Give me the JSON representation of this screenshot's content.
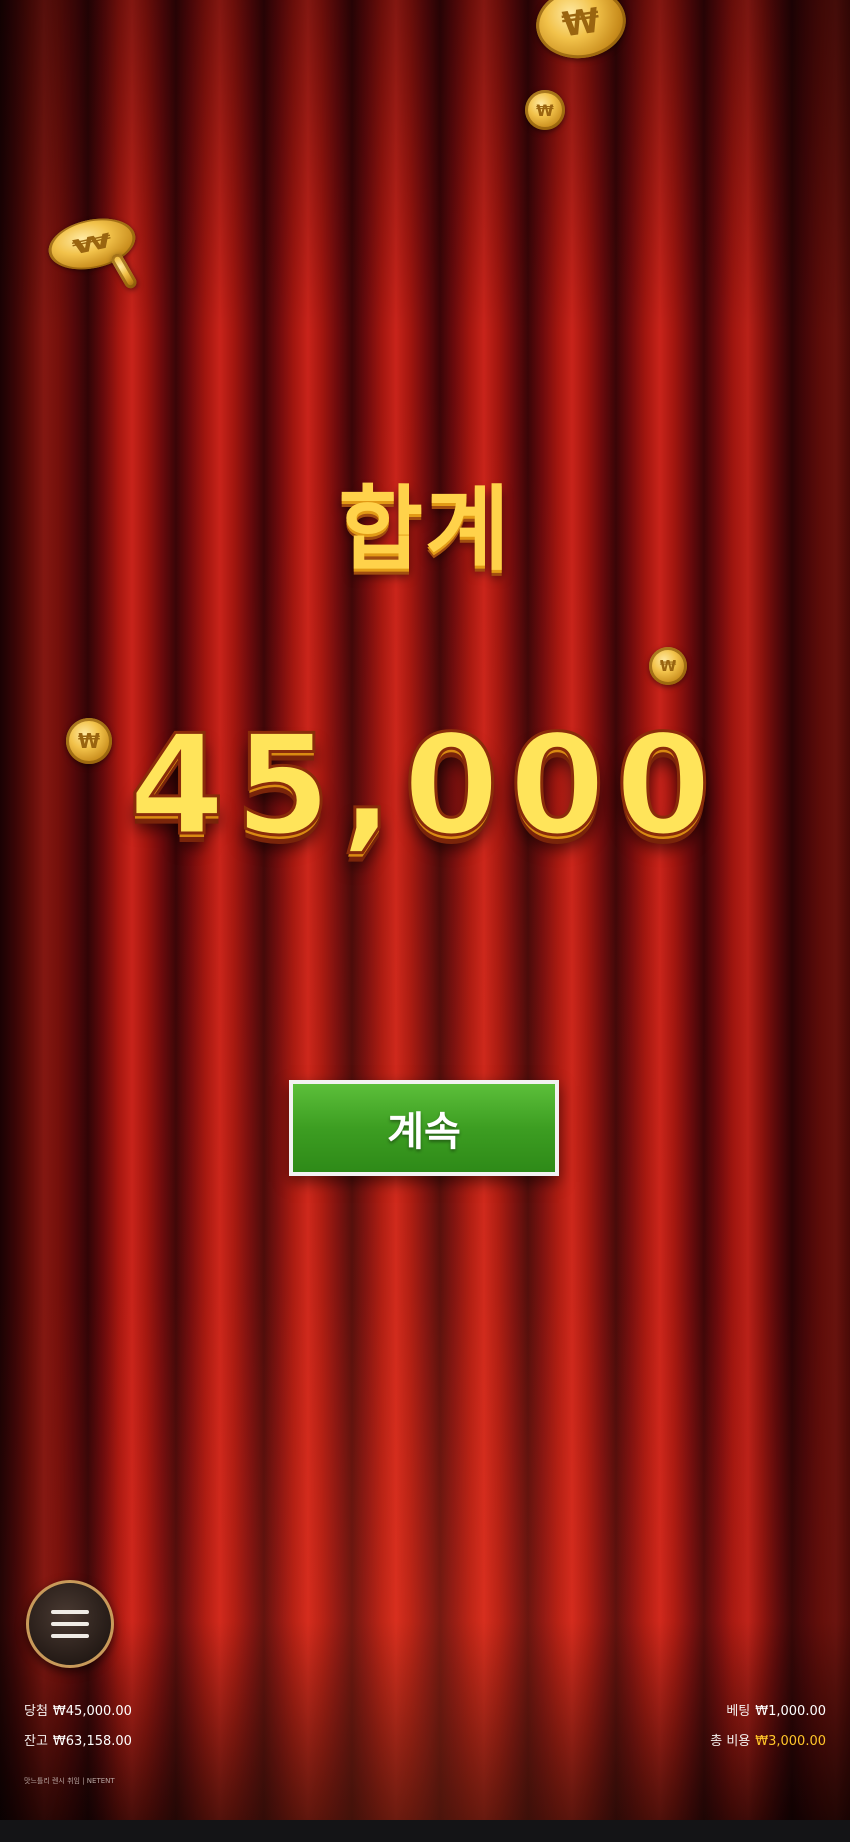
{
  "game": {
    "title": "합계",
    "win_amount": "45,000",
    "continue_label": "계속"
  },
  "coins": {
    "symbol": "₩"
  },
  "menu": {
    "icon": "hamburger-menu-icon"
  },
  "info": {
    "win_label": "당첨",
    "win_value": "₩45,000.00",
    "balance_label": "잔고",
    "balance_value": "₩63,158.00",
    "bet_label": "베팅",
    "bet_value": "₩1,000.00",
    "total_bet_label": "총 비용",
    "total_bet_value": "₩3,000.00"
  },
  "footer": {
    "note": "맛느틀리 렌시 취임 | NETENT"
  },
  "colors": {
    "title_gold": "#ffd24a",
    "button_green": "#3d9e22",
    "total_bet_gold": "#ffc52a"
  }
}
